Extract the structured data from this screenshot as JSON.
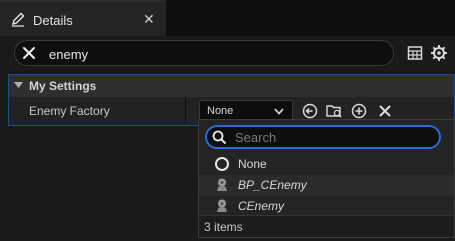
{
  "tab": {
    "title": "Details",
    "close_glyph": "✕",
    "icon": "pencil-icon"
  },
  "search": {
    "value": "enemy"
  },
  "toolbar": {
    "view_icon": "grid-icon",
    "settings_icon": "gear-icon"
  },
  "category": {
    "title": "My Settings"
  },
  "property": {
    "label": "Enemy Factory",
    "value": "None",
    "actions": [
      "use-selected-icon",
      "browse-icon",
      "add-icon",
      "clear-icon"
    ]
  },
  "dropdown": {
    "search_placeholder": "Search",
    "items": [
      {
        "label": "None",
        "icon": "none-circle-icon"
      },
      {
        "label": "BP_CEnemy",
        "icon": "pawn-icon"
      },
      {
        "label": "CEnemy",
        "icon": "pawn-icon"
      }
    ],
    "count": "3 items"
  },
  "colors": {
    "accent": "#2b6bd6",
    "category_border": "#1f4c8f",
    "background": "#1a1a1a"
  }
}
